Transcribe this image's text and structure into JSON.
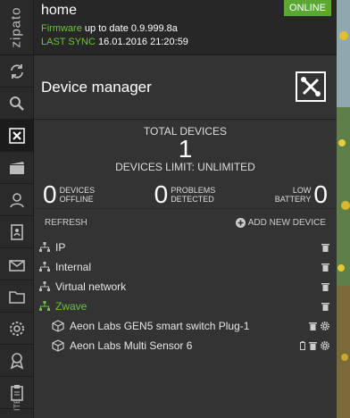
{
  "sidebar": {
    "logo": "zipato",
    "footer_label": "ITE",
    "items": [
      {
        "icon": "sync-icon"
      },
      {
        "icon": "search-icon"
      },
      {
        "icon": "device-manager-icon"
      },
      {
        "icon": "scenes-icon"
      },
      {
        "icon": "users-icon"
      },
      {
        "icon": "contacts-icon"
      },
      {
        "icon": "messages-icon"
      },
      {
        "icon": "folder-icon"
      },
      {
        "icon": "settings-icon"
      },
      {
        "icon": "award-icon"
      },
      {
        "icon": "clipboard-icon"
      }
    ]
  },
  "header": {
    "title": "home",
    "status": "ONLINE",
    "firmware_label": "Firmware",
    "firmware_text": "up to date 0.9.999.8a",
    "sync_label": "LAST SYNC",
    "sync_value": "16.01.2016 21:20:59"
  },
  "device_manager": {
    "title": "Device manager"
  },
  "stats": {
    "total_label": "TOTAL DEVICES",
    "total_value": "1",
    "limit_label": "DEVICES LIMIT: UNLIMITED",
    "offline_value": "0",
    "offline_label_1": "DEVICES",
    "offline_label_2": "OFFLINE",
    "problems_value": "0",
    "problems_label_1": "PROBLEMS",
    "problems_label_2": "DETECTED",
    "battery_value": "0",
    "battery_label_1": "LOW",
    "battery_label_2": "BATTERY"
  },
  "actions": {
    "refresh": "REFRESH",
    "add": "ADD NEW DEVICE"
  },
  "tree": {
    "networks": [
      {
        "label": "IP"
      },
      {
        "label": "Internal"
      },
      {
        "label": "Virtual network"
      },
      {
        "label": "Zwave"
      }
    ],
    "devices": [
      {
        "label": "Aeon Labs GEN5 smart switch Plug-1"
      },
      {
        "label": "Aeon Labs Multi Sensor 6"
      }
    ]
  },
  "colors": {
    "accent_green": "#6cc23e",
    "online_badge": "#5aa832"
  }
}
